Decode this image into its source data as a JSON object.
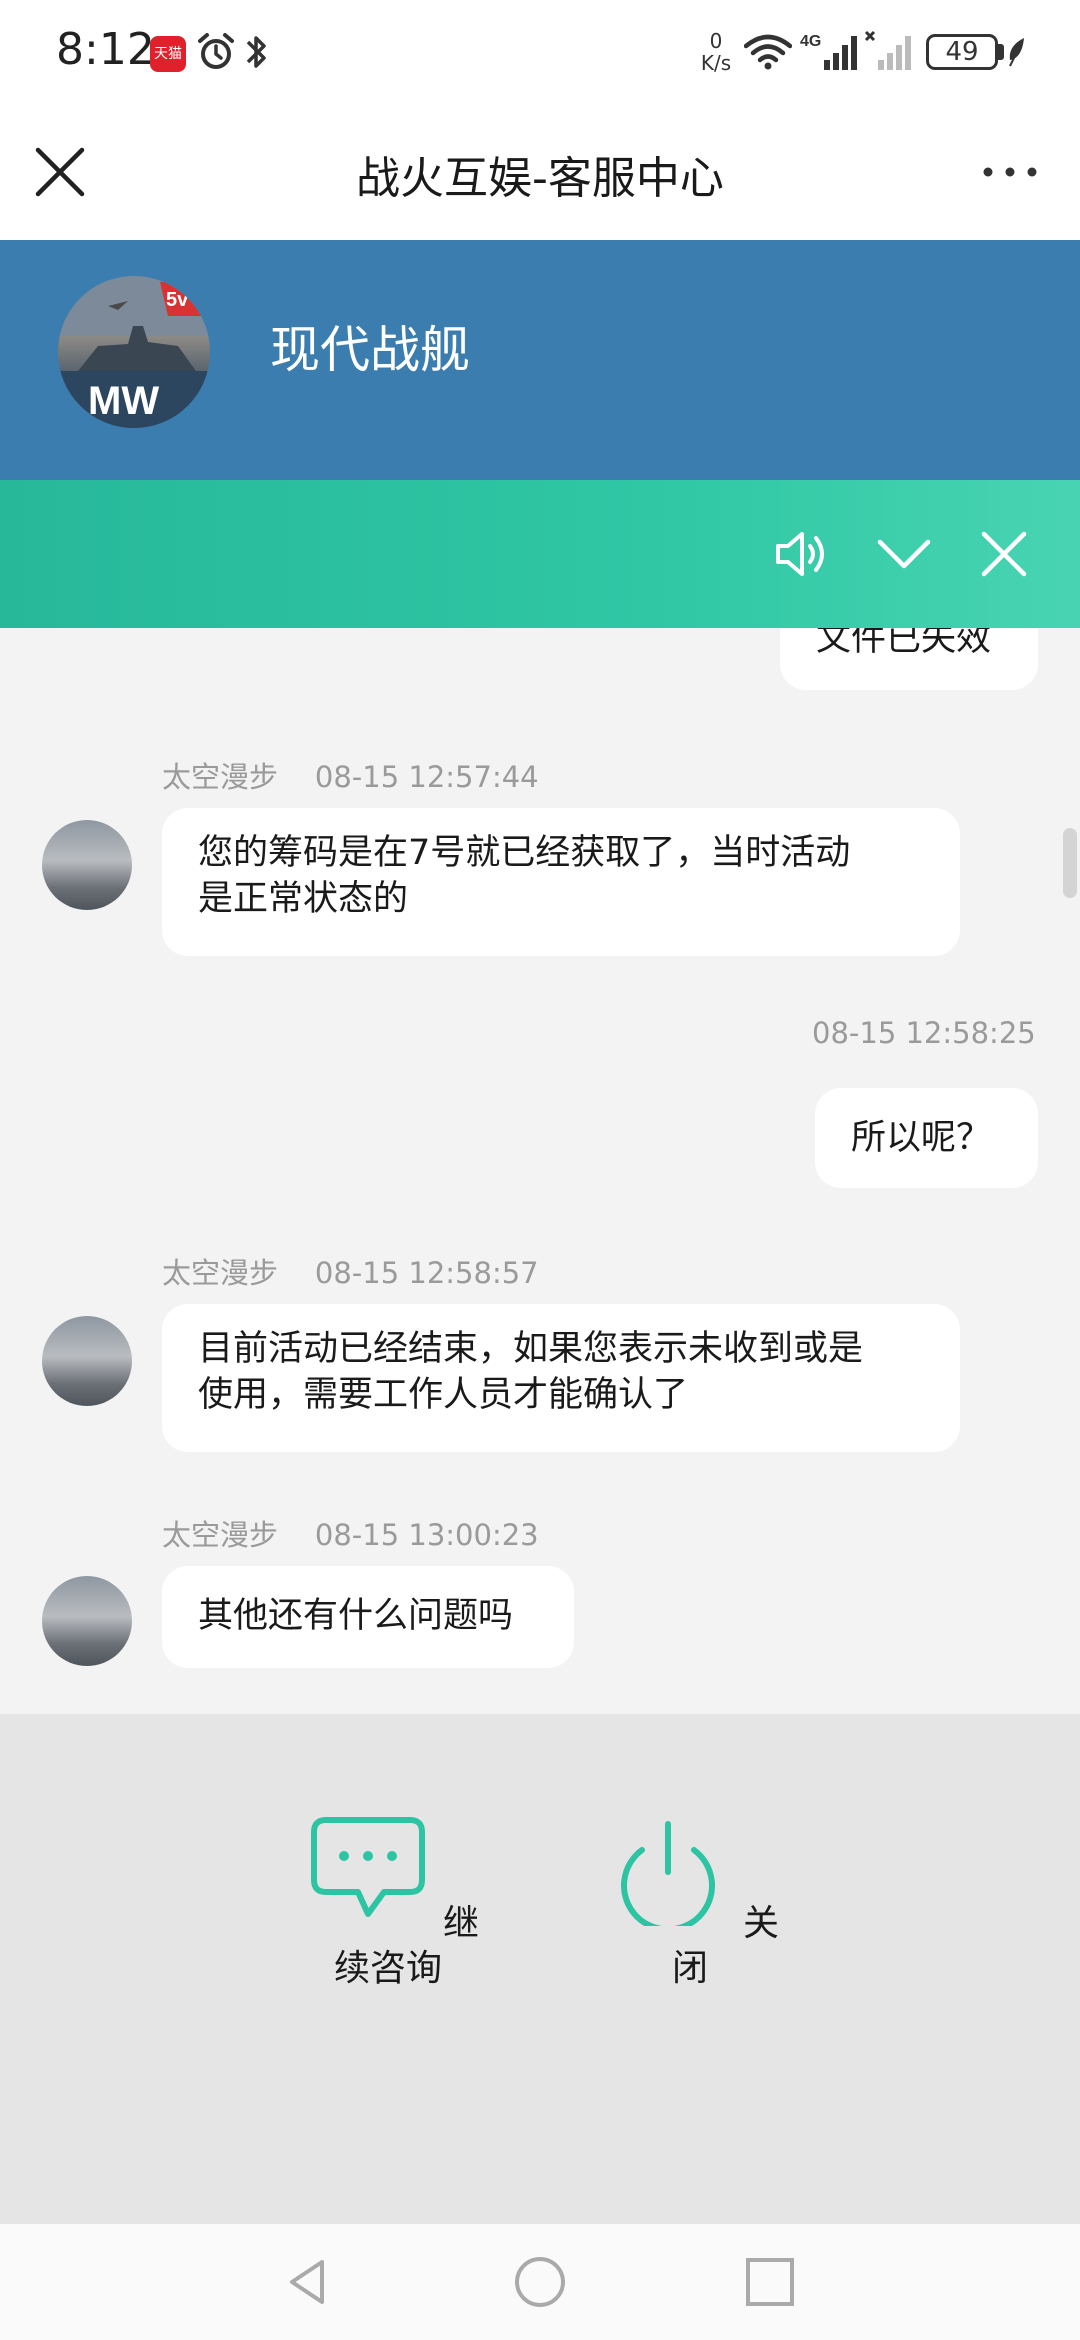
{
  "status_bar": {
    "time": "8:12",
    "app_badge": "天猫",
    "net_speed_value": "0",
    "net_speed_unit": "K/s",
    "network_type": "4G",
    "battery": "49"
  },
  "header": {
    "title": "战火互娱-客服中心"
  },
  "banner": {
    "name": "现代战舰",
    "avatar_badge": "5v",
    "avatar_logo": "MW",
    "color": "#3a7dae"
  },
  "teal_bar": {
    "color": "#2fc7a4",
    "icons": [
      "speaker-icon",
      "chevron-down-icon",
      "close-icon"
    ]
  },
  "chat": {
    "partial_message": "文件已失效",
    "messages": [
      {
        "sender": "太空漫步",
        "time": "08-15 12:57:44",
        "side": "left",
        "lines": [
          "您的筹码是在7号就已经获取了，当时活动",
          "是正常状态的"
        ]
      },
      {
        "sender": "",
        "time": "08-15 12:58:25",
        "side": "right",
        "lines": [
          "所以呢？"
        ]
      },
      {
        "sender": "太空漫步",
        "time": "08-15 12:58:57",
        "side": "left",
        "lines": [
          "目前活动已经结束，如果您表示未收到或是",
          "使用，需要工作人员才能确认了"
        ]
      },
      {
        "sender": "太空漫步",
        "time": "08-15 13:00:23",
        "side": "left",
        "lines": [
          "其他还有什么问题吗"
        ]
      }
    ]
  },
  "actions": {
    "continue": {
      "line1": "继",
      "line2": "续咨询"
    },
    "close": {
      "line1": "关",
      "line2": "闭"
    },
    "icon_color": "#2cc4a3"
  }
}
